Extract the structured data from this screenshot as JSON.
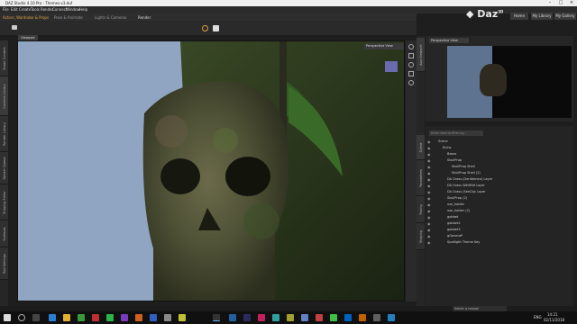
{
  "window": {
    "title": "DAZ Studio 4.10 Pro - Themes-v3.duf"
  },
  "menu": [
    "File",
    "Edit",
    "Create",
    "Tools",
    "Render",
    "Connect",
    "Window",
    "Help"
  ],
  "top_buttons": {
    "home": "Home",
    "library": "My Library",
    "gallery": "My Gallery"
  },
  "lesson_tabs": [
    "Actors, Wardrobe & Props",
    "Pose & Animate",
    "Lights & Cameras",
    "Render"
  ],
  "viewport": {
    "tab": "Viewport",
    "view": "Perspective View"
  },
  "left_tabs": [
    "Smart Content",
    "Content Library",
    "Render Library",
    "Render Queue",
    "Shaping Editor",
    "Surfaces",
    "Tool Settings"
  ],
  "aux": {
    "view": "Perspective View"
  },
  "right_tabs": [
    "Aux Viewport",
    "Scene",
    "Parameters",
    "Posing",
    "Shaping"
  ],
  "scene": {
    "search_placeholder": "Enter text to filter by...",
    "items": [
      {
        "label": "Scene",
        "indent": 0
      },
      {
        "label": "Ruins",
        "indent": 1
      },
      {
        "label": "Bases",
        "indent": 2
      },
      {
        "label": "SkullProp",
        "indent": 2
      },
      {
        "label": "SkullProp Shell",
        "indent": 3
      },
      {
        "label": "SkullProp Shell (2)",
        "indent": 3
      },
      {
        "label": "DA Grass (Gentlemen) Layer",
        "indent": 2
      },
      {
        "label": "DA Grass WildMid Layer",
        "indent": 2
      },
      {
        "label": "DA Grass (SeeClip Layer",
        "indent": 2
      },
      {
        "label": "SkullProp (2)",
        "indent": 2
      },
      {
        "label": "use_holder",
        "indent": 2
      },
      {
        "label": "use_holder (2)",
        "indent": 2
      },
      {
        "label": "gobbet",
        "indent": 2
      },
      {
        "label": "gobbet2",
        "indent": 2
      },
      {
        "label": "gobbet3",
        "indent": 2
      },
      {
        "label": "gGeneraP",
        "indent": 2
      },
      {
        "label": "Spotlight Theme Key",
        "indent": 2
      }
    ]
  },
  "status": {
    "lesson": "Select a Lesson"
  },
  "taskbar": {
    "time": "14:21",
    "date": "02/11/2018",
    "lang": "ENG"
  },
  "colors": {
    "viewport_bg": "#8fa5c2",
    "panel": "#262626",
    "titlebar": "#f0f0f0",
    "accent": "#e07b1a"
  }
}
